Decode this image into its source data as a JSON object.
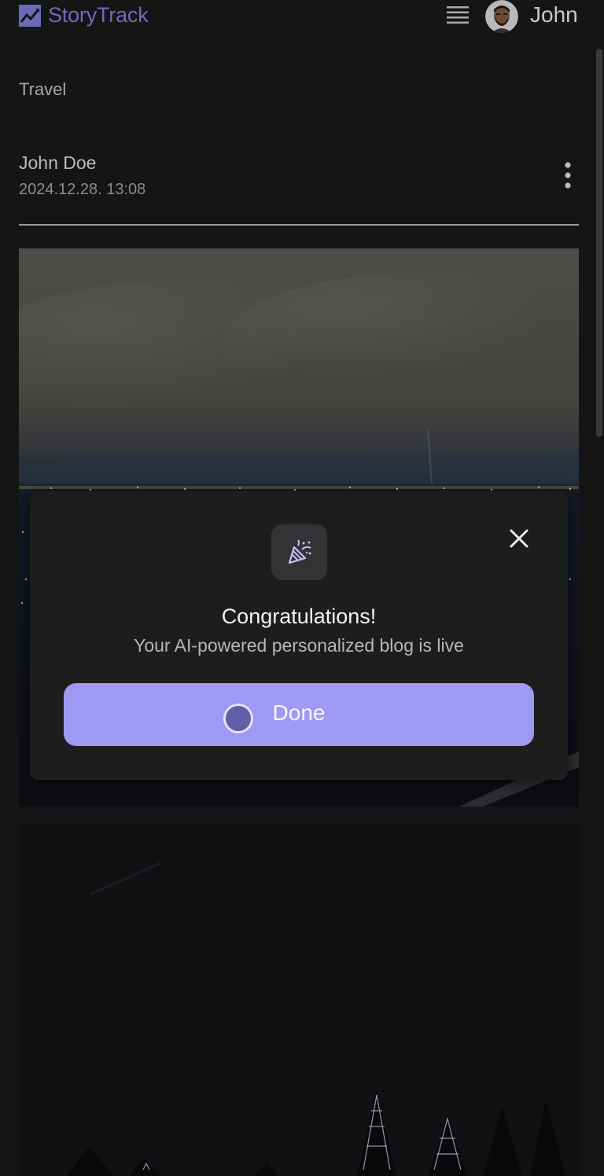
{
  "header": {
    "app_name": "StoryTrack",
    "user_name": "John",
    "brand_color": "#6e6ab9"
  },
  "post": {
    "category": "Travel",
    "author": "John Doe",
    "date": "2024.12.28. 13:08"
  },
  "modal": {
    "icon": "party-popper-icon",
    "title": "Congratulations!",
    "subtitle": "Your AI-powered personalized blog is live",
    "button_label": "Done",
    "button_color": "#a099f4"
  }
}
